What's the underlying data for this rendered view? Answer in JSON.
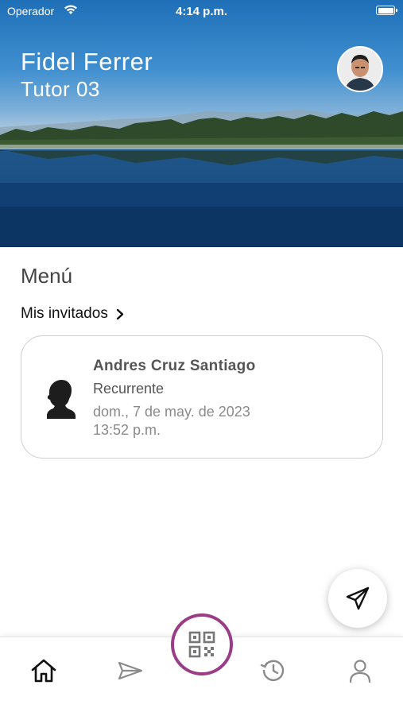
{
  "status_bar": {
    "carrier": "Operador",
    "time": "4:14 p.m."
  },
  "header": {
    "user_name": "Fidel Ferrer",
    "user_role": "Tutor 03"
  },
  "menu": {
    "title": "Menú",
    "section_link": "Mis invitados"
  },
  "guests": [
    {
      "name": "Andres Cruz Santiago",
      "type": "Recurrente",
      "date": "dom., 7 de may. de 2023",
      "time": "13:52 p.m."
    }
  ],
  "icons": {
    "fab": "send-icon",
    "nav": [
      "home-icon",
      "send-icon",
      "qr-code-icon",
      "history-icon",
      "profile-icon"
    ]
  },
  "colors": {
    "qr_accent": "#9a3c86",
    "nav_active": "#111111",
    "nav_inactive": "#8a8a8a"
  }
}
